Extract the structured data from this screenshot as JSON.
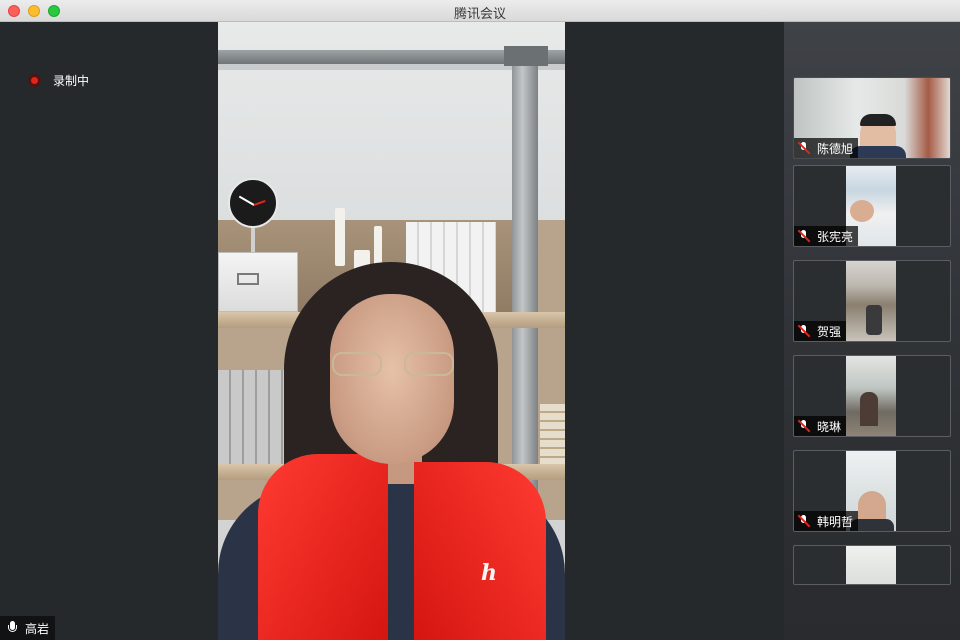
{
  "window": {
    "title": "腾讯会议"
  },
  "recording": {
    "label": "录制中"
  },
  "self_view": {
    "name": "高岩"
  },
  "participants": [
    {
      "name": "陈德旭",
      "mic": "muted-mic-icon"
    },
    {
      "name": "张宪亮",
      "mic": "muted-mic-icon"
    },
    {
      "name": "贺强",
      "mic": "muted-mic-icon"
    },
    {
      "name": "晓琳",
      "mic": "muted-mic-icon"
    },
    {
      "name": "韩明哲",
      "mic": "muted-mic-icon"
    },
    {
      "name": "",
      "mic": ""
    }
  ],
  "colors": {
    "stage_bg": "#26292c",
    "recording_red": "#e1251b",
    "muted_red": "#e1251b",
    "name_tag_bg": "#000000"
  }
}
